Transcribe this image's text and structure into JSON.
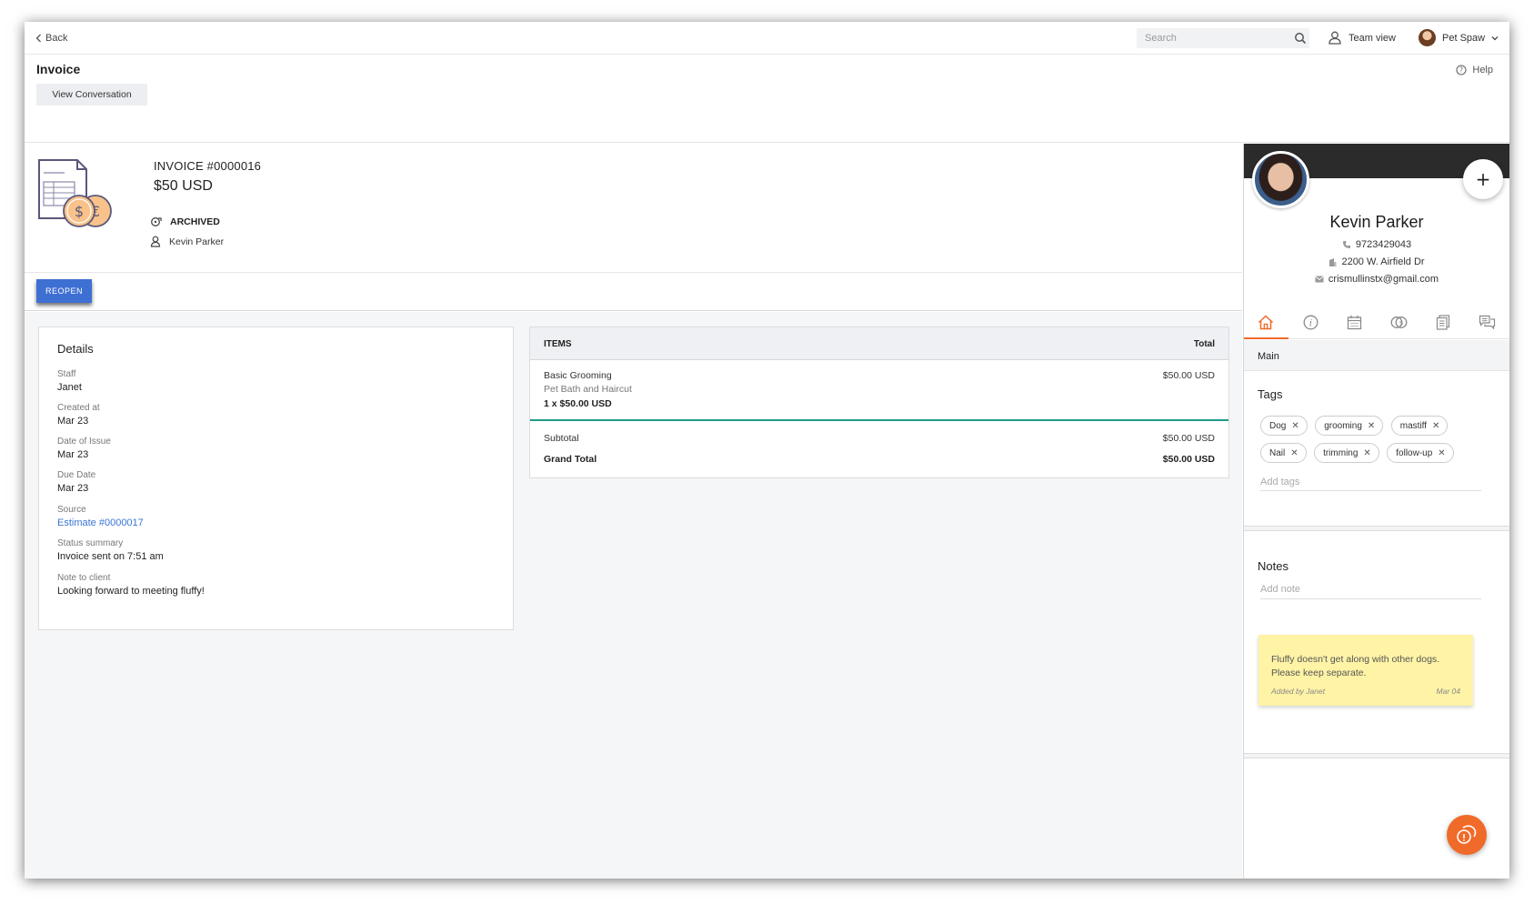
{
  "topbar": {
    "back_label": "Back",
    "search_placeholder": "Search",
    "team_view_label": "Team view",
    "user_name": "Pet Spaw"
  },
  "header": {
    "title": "Invoice",
    "help_label": "Help",
    "view_conversation_label": "View Conversation"
  },
  "invoice": {
    "number": "INVOICE #0000016",
    "amount": "$50 USD",
    "status": "ARCHIVED",
    "client": "Kevin Parker",
    "reopen_label": "REOPEN"
  },
  "details": {
    "title": "Details",
    "fields": [
      {
        "label": "Staff",
        "value": "Janet"
      },
      {
        "label": "Created at",
        "value": "Mar 23"
      },
      {
        "label": "Date of Issue",
        "value": "Mar 23"
      },
      {
        "label": "Due Date",
        "value": "Mar 23"
      },
      {
        "label": "Source",
        "value": "Estimate #0000017"
      },
      {
        "label": "Status summary",
        "value": "Invoice sent on 7:51 am"
      },
      {
        "label": "Note to client",
        "value": "Looking forward to meeting fluffy!"
      }
    ]
  },
  "items": {
    "col_items": "ITEMS",
    "col_total": "Total",
    "rows": [
      {
        "name": "Basic Grooming",
        "description": "Pet Bath and Haircut",
        "qty_line": "1 x $50.00 USD",
        "price": "$50.00 USD"
      }
    ],
    "subtotal_label": "Subtotal",
    "subtotal_value": "$50.00 USD",
    "grand_total_label": "Grand Total",
    "grand_total_value": "$50.00 USD"
  },
  "contact": {
    "name": "Kevin Parker",
    "phone": "9723429043",
    "address": "2200 W. Airfield Dr",
    "email": "crismullinstx@gmail.com",
    "tabs": [
      "home-icon",
      "info-icon",
      "calendar-icon",
      "coins-icon",
      "document-icon",
      "chat-icon"
    ],
    "section_label": "Main",
    "tags_title": "Tags",
    "tags": [
      "Dog",
      "grooming",
      "mastiff",
      "Nail",
      "trimming",
      "follow-up"
    ],
    "add_tags_placeholder": "Add tags",
    "notes_title": "Notes",
    "add_note_placeholder": "Add note",
    "note": {
      "text": "Fluffy doesn't get along with other dogs. Please keep separate.",
      "added_by": "Added by Janet",
      "date": "Mar 04"
    }
  },
  "colors": {
    "accent": "#f06a2a",
    "primary_button": "#3e6fd3",
    "link": "#3a74d6",
    "divider_teal": "#1f9a88",
    "note_bg": "#fff3a6"
  }
}
